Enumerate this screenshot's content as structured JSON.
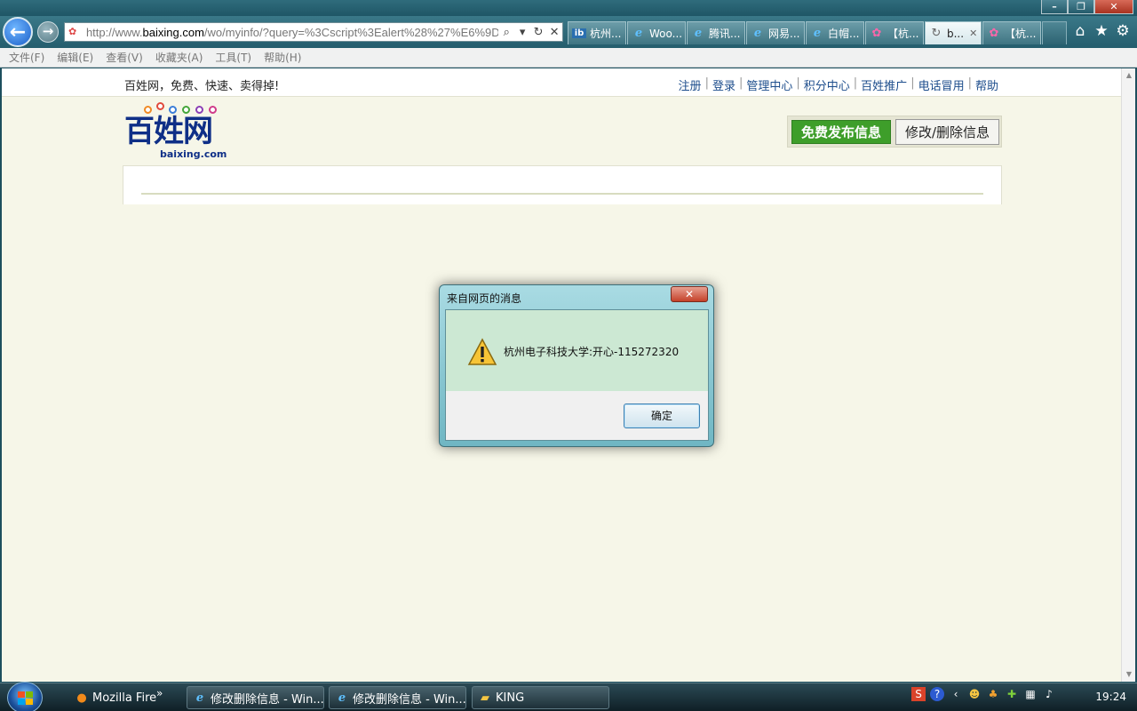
{
  "window": {
    "minimize": "–",
    "restore": "❐",
    "close": "✕"
  },
  "browser": {
    "address_prefix": "http://www.",
    "address_domain": "baixing.com",
    "address_rest": "/wo/myinfo/?query=%3Cscript%3Ealert%28%27%E6%9D",
    "tabs": [
      {
        "label": "杭州...",
        "icon": "ib",
        "active": false
      },
      {
        "label": "Woo...",
        "icon": "ie",
        "active": false
      },
      {
        "label": "腾讯...",
        "icon": "ie",
        "active": false
      },
      {
        "label": "网易...",
        "icon": "ie",
        "active": false
      },
      {
        "label": "白帽...",
        "icon": "ie",
        "active": false
      },
      {
        "label": "【杭...",
        "icon": "pin",
        "active": false
      },
      {
        "label": "b...",
        "icon": "load",
        "active": true
      },
      {
        "label": "【杭...",
        "icon": "pin",
        "active": false
      }
    ],
    "menu": [
      "文件(F)",
      "编辑(E)",
      "查看(V)",
      "收藏夹(A)",
      "工具(T)",
      "帮助(H)"
    ]
  },
  "page": {
    "slogan": "百姓网，免费、快速、卖得掉!",
    "top_links": [
      "注册",
      "登录",
      "管理中心",
      "积分中心",
      "百姓推广",
      "电话冒用",
      "帮助"
    ],
    "logo_text": "百姓网",
    "logo_domain": "baixing.com",
    "post_button": "免费发布信息",
    "edit_button": "修改/删除信息"
  },
  "dialog": {
    "title": "来自网页的消息",
    "message": "杭州电子科技大学:开心-115272320",
    "ok_label": "确定",
    "close_label": "✕"
  },
  "taskbar": {
    "buttons": [
      {
        "label": "Mozilla Fire",
        "icon": "firefox-icon"
      },
      {
        "label": "修改删除信息 - Win...",
        "icon": "ie-icon"
      },
      {
        "label": "修改删除信息 - Win...",
        "icon": "ie-icon"
      },
      {
        "label": "KING",
        "icon": "folder-icon"
      }
    ],
    "more": "»",
    "time": "19:24"
  },
  "colors": {
    "brand_blue": "#0f2f87",
    "post_green": "#3e9e2a",
    "page_bg": "#f6f6e8"
  }
}
